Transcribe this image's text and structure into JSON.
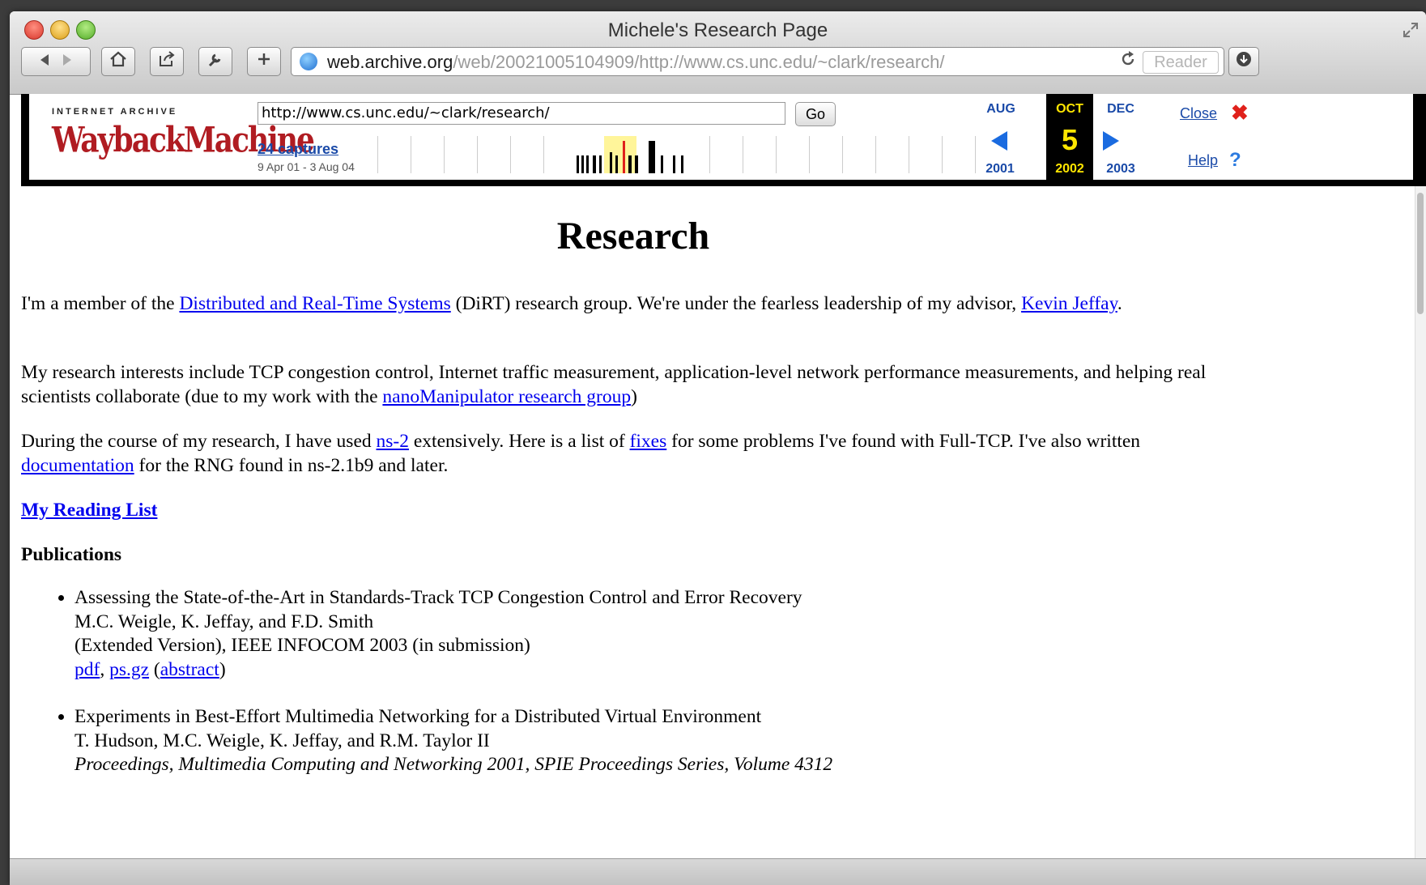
{
  "window": {
    "title": "Michele's Research Page"
  },
  "toolbar": {
    "url_domain": "web.archive.org",
    "url_path": "/web/20021005104909/http://www.cs.unc.edu/~clark/research/",
    "reader_label": "Reader"
  },
  "wayback": {
    "logo_top": "INTERNET ARCHIVE",
    "logo": "WaybackMachine",
    "url_value": "http://www.cs.unc.edu/~clark/research/",
    "go_label": "Go",
    "captures": "24 captures",
    "range": "9 Apr 01 - 3 Aug 04",
    "prev_month": "AUG",
    "cur_month": "OCT",
    "next_month": "DEC",
    "prev_year": "2001",
    "cur_day": "5",
    "cur_year": "2002",
    "next_year": "2003",
    "close": "Close",
    "help": "Help"
  },
  "page": {
    "title": "Research",
    "p1": {
      "a": "I'm a member of the ",
      "link1": "Distributed and Real-Time Systems",
      "b": " (DiRT) research group. We're under the fearless leadership of my advisor, ",
      "link2": "Kevin Jeffay",
      "c": "."
    },
    "p2": {
      "a": "My research interests include TCP congestion control, Internet traffic measurement, application-level network performance measurements, and helping real scientists collaborate (due to my work with the ",
      "link1": "nanoManipulator research group",
      "b": ")"
    },
    "p3": {
      "a": "During the course of my research, I have used ",
      "link1": "ns-2",
      "b": " extensively. Here is a list of ",
      "link2": "fixes",
      "c": " for some problems I've found with Full-TCP. I've also written ",
      "link3": "documentation",
      "d": " for the RNG found in ns-2.1b9 and later."
    },
    "reading_list": "My Reading List",
    "publications_heading": "Publications",
    "pubs": [
      {
        "title": "Assessing the State-of-the-Art in Standards-Track TCP Congestion Control and Error Recovery",
        "authors": "M.C. Weigle, K. Jeffay, and F.D. Smith",
        "venue": "(Extended Version), IEEE INFOCOM 2003 (in submission)",
        "link_pdf": "pdf",
        "sep1": ", ",
        "link_ps": "ps.gz",
        "sep2": " (",
        "link_abstract": "abstract",
        "sep3": ")"
      },
      {
        "title": "Experiments in Best-Effort Multimedia Networking for a Distributed Virtual Environment",
        "authors": "T. Hudson, M.C. Weigle, K. Jeffay, and R.M. Taylor II",
        "venue": "Proceedings, Multimedia Computing and Networking 2001, SPIE Proceedings Series, Volume 4312"
      }
    ]
  }
}
